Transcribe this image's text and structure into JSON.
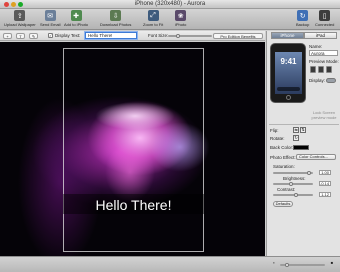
{
  "window": {
    "title": "iPhone (320x480) - Aurora"
  },
  "toolbar": {
    "items": [
      {
        "label": "Upload Wallpaper",
        "icon": "upload-icon",
        "color": "#5a5a5a"
      },
      {
        "label": "Send Email",
        "icon": "email-icon",
        "color": "#6b7f99"
      },
      {
        "label": "Add to iPhoto",
        "icon": "iphoto-icon",
        "color": "#4f8a4f"
      },
      {
        "label": "Download Photos",
        "icon": "download-photos-icon",
        "color": "#5c7a52"
      },
      {
        "label": "Zoom to Fit",
        "icon": "zoom-to-fit-icon",
        "color": "#3e5b7d"
      },
      {
        "label": "iPhoto",
        "icon": "iphoto-app-icon",
        "color": "#5a4a6a"
      },
      {
        "label": "Backup",
        "icon": "backup-icon",
        "color": "#3f6fb5"
      },
      {
        "label": "Connected",
        "icon": "connected-icon",
        "color": "#3d3d3d"
      }
    ]
  },
  "options_bar": {
    "display_text_label": "Display Text:",
    "display_text_checked": true,
    "text_value": "Hello There!",
    "font_size_label": "Font Size:",
    "pro_button": "Pro Edition Benefits"
  },
  "canvas": {
    "overlay_text": "Hello There!"
  },
  "panel": {
    "tabs": [
      "iPhone",
      "iPad"
    ],
    "active_tab": "iPhone",
    "phone_time": "9:41",
    "name_label": "Name:",
    "name_value": "Aurora",
    "preview_mode_label": "Preview Mode:",
    "display_label": "Display:",
    "hint": "Lock Screen preview mode",
    "flip_label": "Flip:",
    "rotate_label": "Rotate:",
    "back_color_label": "Back Color:",
    "photo_effect_label": "Photo Effect:",
    "photo_effect_value": "Color Controls...",
    "saturation_label": "Saturation:",
    "saturation_value": "1.00",
    "brightness_label": "Brightness:",
    "brightness_value": "-0.14",
    "contrast_label": "Contrast:",
    "contrast_value": "1.12",
    "defaults_button": "Defaults"
  }
}
